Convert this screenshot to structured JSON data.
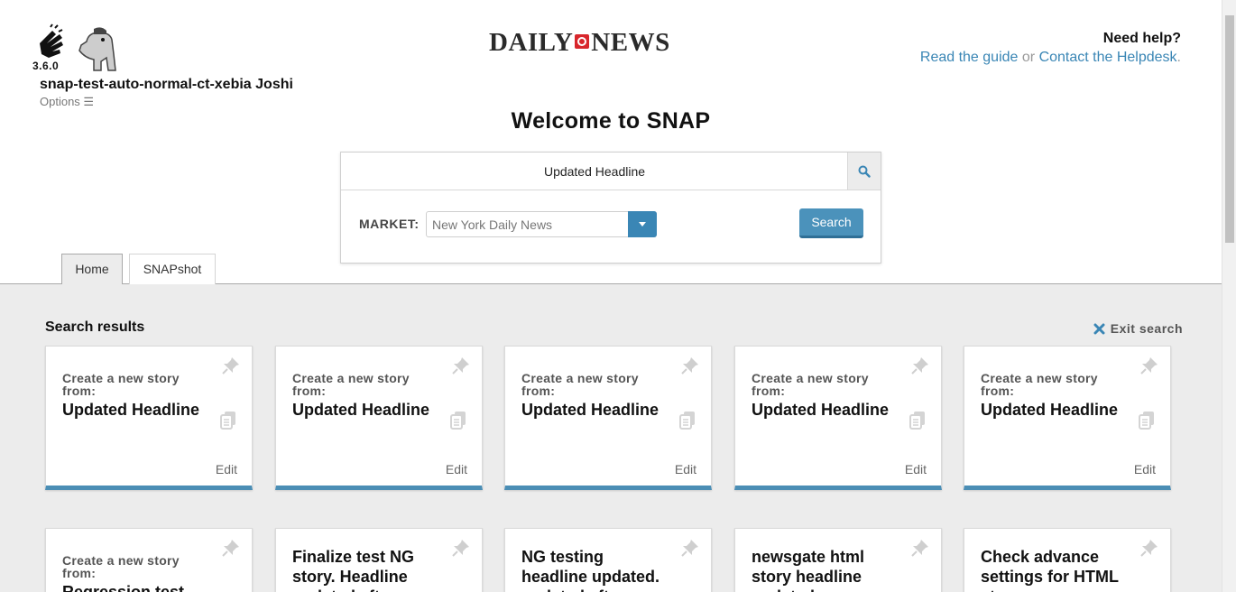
{
  "app": {
    "version": "3.6.0",
    "username": "snap-test-auto-normal-ct-xebia Joshi",
    "options_label": "Options ☰",
    "masthead_left": "DAILY",
    "masthead_right": "NEWS"
  },
  "help": {
    "title": "Need help?",
    "guide_link": "Read the guide",
    "or_text": "or",
    "helpdesk_link": "Contact the Helpdesk",
    "period": "."
  },
  "welcome": "Welcome to SNAP",
  "search": {
    "query": "Updated Headline",
    "market_label": "MARKET:",
    "market_value": "New York Daily News",
    "submit_label": "Search"
  },
  "tabs": [
    {
      "label": "Home",
      "active": true
    },
    {
      "label": "SNAPshot",
      "active": false
    }
  ],
  "results": {
    "title": "Search results",
    "exit_label": "Exit search"
  },
  "cards_row1": [
    {
      "label": "Create a new story from:",
      "headline": "Updated Headline",
      "edit": "Edit"
    },
    {
      "label": "Create a new story from:",
      "headline": "Updated Headline",
      "edit": "Edit"
    },
    {
      "label": "Create a new story from:",
      "headline": "Updated Headline",
      "edit": "Edit"
    },
    {
      "label": "Create a new story from:",
      "headline": "Updated Headline",
      "edit": "Edit"
    },
    {
      "label": "Create a new story from:",
      "headline": "Updated Headline",
      "edit": "Edit"
    }
  ],
  "cards_row2": [
    {
      "label": "Create a new story from:",
      "headline": "Regression test"
    },
    {
      "title": "Finalize test NG story. Headline updated after"
    },
    {
      "title": "NG testing headline updated. updated after"
    },
    {
      "title": "newsgate html story headline updated"
    },
    {
      "title": "Check advance settings for HTML story"
    }
  ],
  "colors": {
    "accent": "#4b92bb",
    "link": "#3a86b5",
    "brand_red": "#d8262c"
  }
}
